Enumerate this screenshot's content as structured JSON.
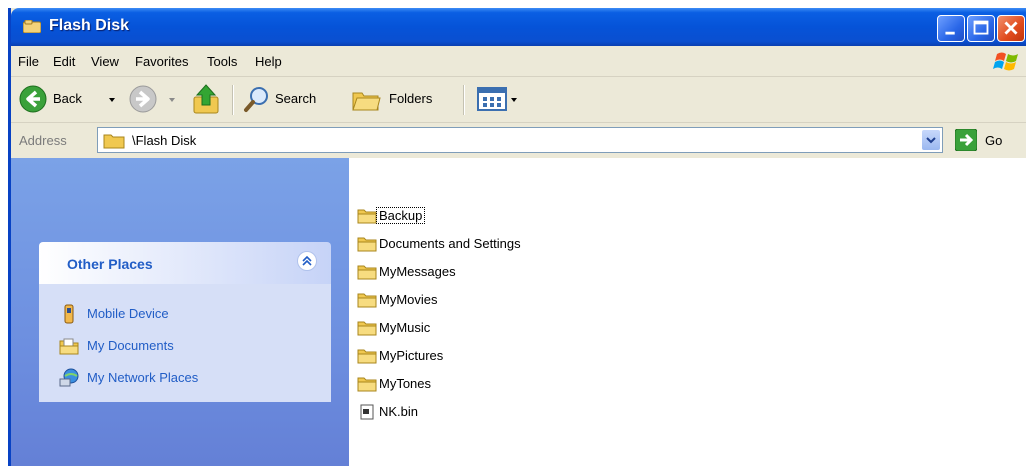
{
  "window": {
    "title": "Flash Disk"
  },
  "menubar": {
    "items": [
      "File",
      "Edit",
      "View",
      "Favorites",
      "Tools",
      "Help"
    ]
  },
  "toolbar": {
    "back_label": "Back",
    "search_label": "Search",
    "folders_label": "Folders"
  },
  "address": {
    "label": "Address",
    "value": "\\Flash Disk",
    "go_label": "Go"
  },
  "other_places": {
    "title": "Other Places",
    "items": [
      {
        "label": "Mobile Device",
        "icon": "mobile-device-icon"
      },
      {
        "label": "My Documents",
        "icon": "my-documents-folder-icon"
      },
      {
        "label": "My Network Places",
        "icon": "network-places-icon"
      }
    ]
  },
  "files": [
    {
      "name": "Backup",
      "icon": "folder-icon"
    },
    {
      "name": "Documents and Settings",
      "icon": "folder-icon"
    },
    {
      "name": "MyMessages",
      "icon": "folder-icon"
    },
    {
      "name": "MyMovies",
      "icon": "folder-icon"
    },
    {
      "name": "MyMusic",
      "icon": "folder-icon"
    },
    {
      "name": "MyPictures",
      "icon": "folder-icon"
    },
    {
      "name": "MyTones",
      "icon": "folder-icon"
    },
    {
      "name": "NK.bin",
      "icon": "file-icon"
    }
  ],
  "colors": {
    "titlebar": "#0653d8",
    "taskpane": "#7ba2e7",
    "link": "#215dc6"
  }
}
